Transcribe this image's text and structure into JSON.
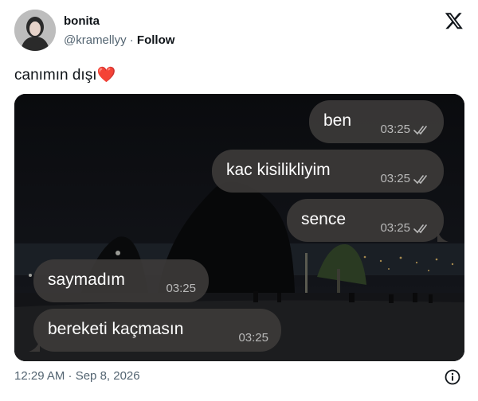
{
  "author": {
    "display_name": "bonita",
    "handle": "@kramellyy",
    "separator": "·",
    "follow_label": "Follow"
  },
  "tweet": {
    "text": "canımın dışı",
    "emoji": "❤️"
  },
  "chat": {
    "messages": [
      {
        "text": "ben",
        "time": "03:25",
        "side": "right",
        "read": true
      },
      {
        "text": "kac kisilikliyim",
        "time": "03:25",
        "side": "right",
        "read": true
      },
      {
        "text": "sence",
        "time": "03:25",
        "side": "right",
        "read": true
      },
      {
        "text": "saymadım",
        "time": "03:25",
        "side": "left",
        "read": false
      },
      {
        "text": "bereketi kaçmasın",
        "time": "03:25",
        "side": "left",
        "read": false
      }
    ]
  },
  "footer": {
    "timestamp": "12:29 AM · Sep 8, 2026"
  },
  "icons": {
    "logo": "x-logo-icon",
    "info": "info-icon",
    "read_receipt": "double-check-icon"
  },
  "colors": {
    "bubble": "#3c3a38",
    "meta_text": "#b9b9b9",
    "heart": "#e0245e",
    "muted_text": "#536471"
  }
}
